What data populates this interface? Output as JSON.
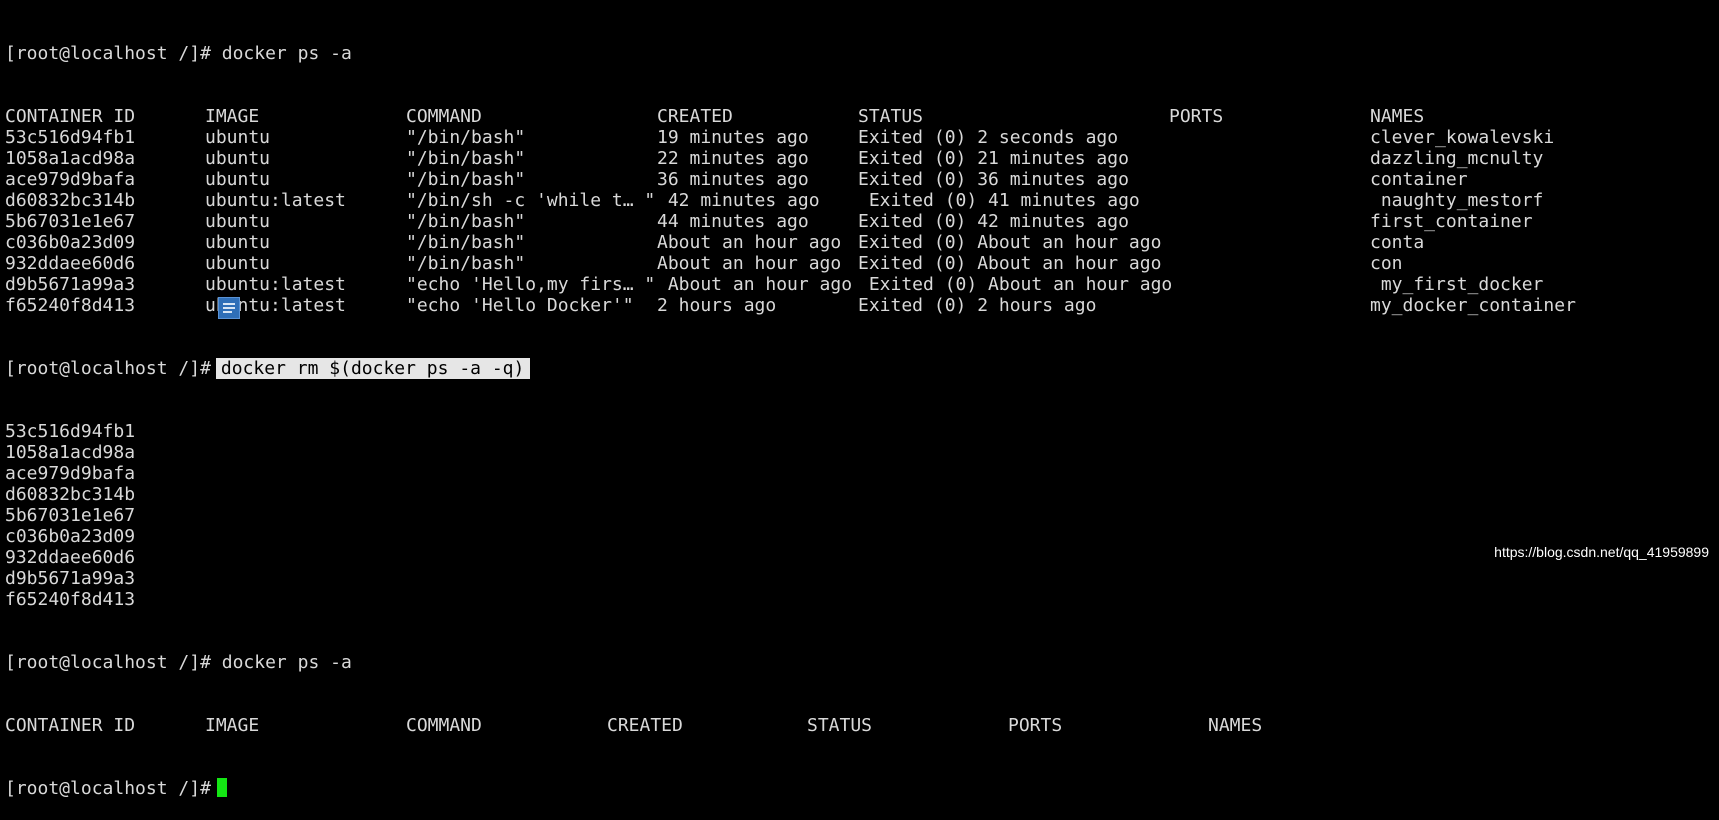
{
  "colors": {
    "background": "#000000",
    "text": "#d9d9d9",
    "cursor": "#14e614",
    "selection": "#e6e6e6"
  },
  "prompt": "[root@localhost /]#",
  "cmd1": " docker ps -a",
  "table1": {
    "headers": [
      "CONTAINER ID",
      "IMAGE",
      "COMMAND",
      "CREATED",
      "STATUS",
      "PORTS",
      "NAMES"
    ],
    "rows": [
      [
        "53c516d94fb1",
        "ubuntu",
        "\"/bin/bash\"",
        "19 minutes ago",
        "Exited (0) 2 seconds ago",
        "",
        "clever_kowalevski"
      ],
      [
        "1058a1acd98a",
        "ubuntu",
        "\"/bin/bash\"",
        "22 minutes ago",
        "Exited (0) 21 minutes ago",
        "",
        "dazzling_mcnulty"
      ],
      [
        "ace979d9bafa",
        "ubuntu",
        "\"/bin/bash\"",
        "36 minutes ago",
        "Exited (0) 36 minutes ago",
        "",
        "container"
      ],
      [
        "d60832bc314b",
        "ubuntu:latest",
        "\"/bin/sh -c 'while t… \"",
        " 42 minutes ago",
        " Exited (0) 41 minutes ago",
        "",
        " naughty_mestorf"
      ],
      [
        "5b67031e1e67",
        "ubuntu",
        "\"/bin/bash\"",
        "44 minutes ago",
        "Exited (0) 42 minutes ago",
        "",
        "first_container"
      ],
      [
        "c036b0a23d09",
        "ubuntu",
        "\"/bin/bash\"",
        "About an hour ago",
        "Exited (0) About an hour ago",
        "",
        "conta"
      ],
      [
        "932ddaee60d6",
        "ubuntu",
        "\"/bin/bash\"",
        "About an hour ago",
        "Exited (0) About an hour ago",
        "",
        "con"
      ],
      [
        "d9b5671a99a3",
        "ubuntu:latest",
        "\"echo 'Hello,my firs… \"",
        " About an hour ago",
        " Exited (0) About an hour ago",
        "",
        " my_first_docker"
      ],
      [
        "f65240f8d413",
        "ubuntu:latest",
        "\"echo 'Hello Docker'\"",
        "2 hours ago",
        "Exited (0) 2 hours ago",
        "",
        "my_docker_container"
      ]
    ]
  },
  "cmd2": "docker rm $(docker ps -a -q)",
  "removed": [
    "53c516d94fb1",
    "1058a1acd98a",
    "ace979d9bafa",
    "d60832bc314b",
    "5b67031e1e67",
    "c036b0a23d09",
    "932ddaee60d6",
    "d9b5671a99a3",
    "f65240f8d413"
  ],
  "cmd3": " docker ps -a",
  "table2": {
    "headers": [
      "CONTAINER ID",
      "IMAGE",
      "COMMAND",
      "CREATED",
      "STATUS",
      "PORTS",
      "NAMES"
    ]
  },
  "icons": {
    "note": "document-note-icon",
    "cursor": "terminal-cursor"
  },
  "watermark": "https://blog.csdn.net/qq_41959899"
}
